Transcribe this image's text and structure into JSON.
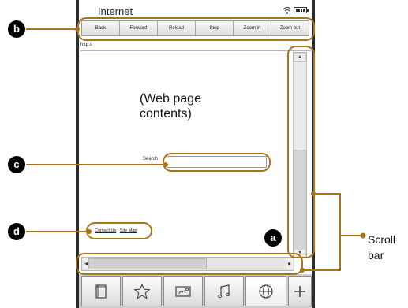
{
  "status": {
    "title": "Internet",
    "icons": [
      "wifi-icon",
      "battery-icon"
    ]
  },
  "toolbar": {
    "buttons": [
      {
        "label": "Back"
      },
      {
        "label": "Forward"
      },
      {
        "label": "Reload"
      },
      {
        "label": "Stop"
      },
      {
        "label": "Zoom in"
      },
      {
        "label": "Zoom out"
      }
    ]
  },
  "url": {
    "value": "http://"
  },
  "page": {
    "contents": "(Web page\ncontents)",
    "search_label": "Search",
    "footer_link_1": "Contact Us",
    "footer_separator": "|",
    "footer_link_2": "Site Map"
  },
  "dock": {
    "items": [
      "book-icon",
      "star-icon",
      "picture-icon",
      "music-icon",
      "globe-icon",
      "plus-icon"
    ]
  },
  "callouts": {
    "a": "a",
    "b": "b",
    "c": "c",
    "d": "d",
    "scroll_label": "Scroll\nbar"
  },
  "colors": {
    "callout": "#a87618",
    "badge": "#000000",
    "device_frame": "#2b2b2b"
  }
}
